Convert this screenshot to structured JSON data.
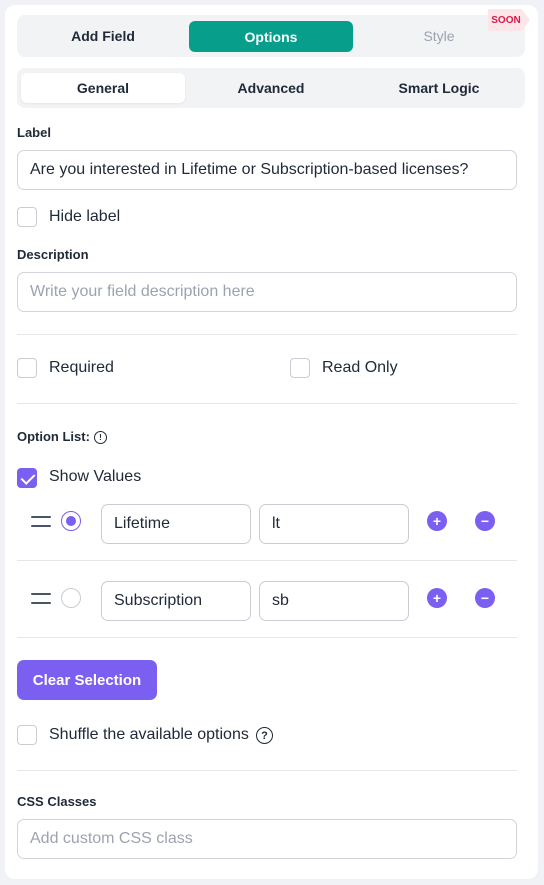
{
  "top_tabs": {
    "add_field": "Add Field",
    "options": "Options",
    "style": "Style",
    "soon_badge": "SOON"
  },
  "sub_tabs": {
    "general": "General",
    "advanced": "Advanced",
    "smart_logic": "Smart Logic"
  },
  "label_section": {
    "title": "Label",
    "value": "Are you interested in Lifetime or Subscription-based licenses?"
  },
  "hide_label": {
    "text": "Hide label",
    "checked": false
  },
  "description": {
    "title": "Description",
    "placeholder": "Write your field description here"
  },
  "required": {
    "text": "Required",
    "checked": false
  },
  "read_only": {
    "text": "Read Only",
    "checked": false
  },
  "option_list": {
    "title": "Option List:",
    "help_icon": "help-circle-icon",
    "show_values": {
      "text": "Show Values",
      "checked": true
    },
    "options": [
      {
        "label": "Lifetime",
        "value": "lt",
        "selected": true
      },
      {
        "label": "Subscription",
        "value": "sb",
        "selected": false
      }
    ],
    "add_symbol": "+",
    "remove_symbol": "−"
  },
  "clear_selection": "Clear Selection",
  "shuffle": {
    "text": "Shuffle the available options",
    "checked": false,
    "help_symbol": "?"
  },
  "css_classes": {
    "title": "CSS Classes",
    "placeholder": "Add custom CSS class"
  },
  "colors": {
    "accent_teal": "#079e8c",
    "accent_purple": "#7b5ff0",
    "soon_red": "#d81b47"
  }
}
